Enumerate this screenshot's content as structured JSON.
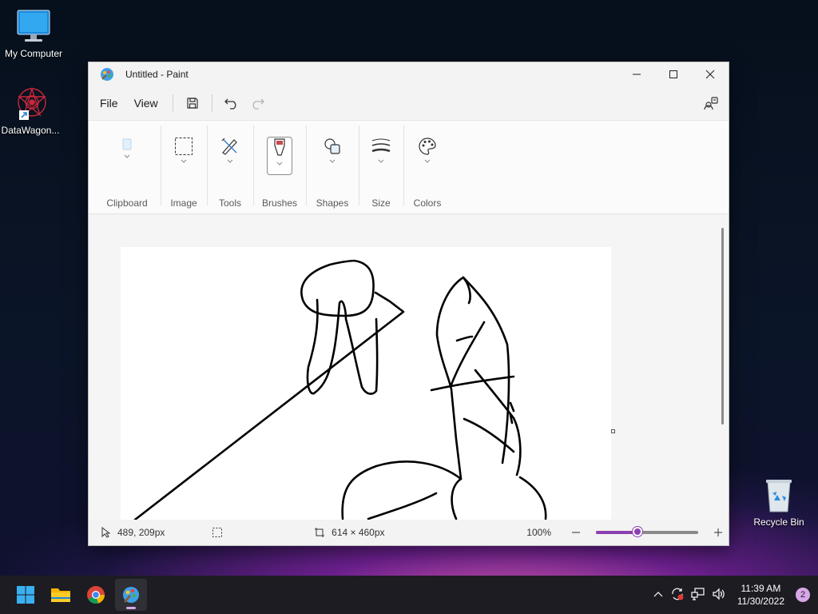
{
  "desktop": {
    "icons": [
      {
        "label": "My Computer"
      },
      {
        "label": "DataWagon..."
      },
      {
        "label": "Recycle Bin"
      }
    ]
  },
  "window": {
    "title": "Untitled - Paint",
    "menu": {
      "file": "File",
      "view": "View"
    },
    "ribbon": {
      "groups": [
        "Clipboard",
        "Image",
        "Tools",
        "Brushes",
        "Shapes",
        "Size",
        "Colors"
      ]
    }
  },
  "status": {
    "cursor_position": "489, 209px",
    "canvas_size": "614 × 460px",
    "zoom_label": "100%",
    "zoom_fraction": 0.4
  },
  "taskbar": {
    "time": "11:39 AM",
    "date": "11/30/2022",
    "notification_count": "2"
  },
  "colors": {
    "accent": "#8c3fb0",
    "taskbar": "#1c1c22"
  }
}
